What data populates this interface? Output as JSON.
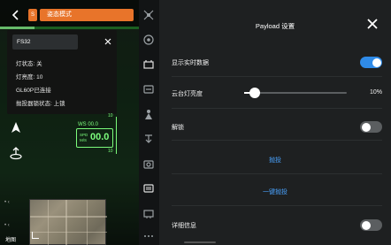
{
  "top_bar": {
    "mode_tag": "S",
    "mode_label": "姿态模式",
    "signal_level": 0.25
  },
  "device_panel": {
    "device_name": "FS32",
    "lines": [
      "灯状态: 关",
      "灯亮度: 10",
      "GL60P已连接",
      "抛投器锁状态: 上锁"
    ]
  },
  "hud": {
    "ws_label": "WS 00.0",
    "speed_unit": "SPD M/S",
    "speed_value": "00.0",
    "tick_top": "10",
    "tick_bottom": "10"
  },
  "map": {
    "label": "地图",
    "dots_top": "• ‹",
    "dots_bottom": "• ‹"
  },
  "panel": {
    "title": "Payload 设置",
    "rows": {
      "realtime_label": "显示实时数据",
      "brightness_label": "云台灯亮度",
      "brightness_value": "10%",
      "brightness_fraction": 0.1,
      "unlock_label": "解锁",
      "drop_label": "抛投",
      "drop_all_label": "一键抛投",
      "details_label": "详细信息"
    },
    "toggles": {
      "realtime": true,
      "unlock": false,
      "details": false
    }
  },
  "colors": {
    "accent_orange": "#e8742a",
    "toggle_on": "#2f8be8",
    "link_blue": "#4aa3ff",
    "hud_green": "#7cfc7c"
  },
  "rail_icons": [
    "gimbal-icon",
    "target-icon",
    "payload-icon",
    "camera-settings-icon",
    "person-icon",
    "drop-icon",
    "camera-icon",
    "speaker-icon",
    "display-icon",
    "more-icon"
  ]
}
